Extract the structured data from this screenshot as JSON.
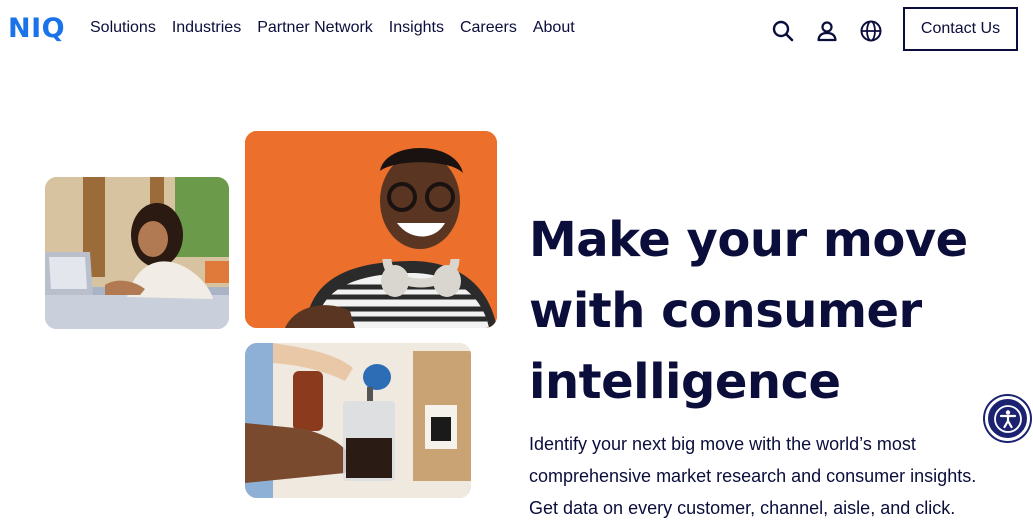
{
  "brand": {
    "logo_text": "NIQ",
    "accent": "#1a73e8",
    "text_color": "#0b0d3b"
  },
  "nav": {
    "items": [
      {
        "label": "Solutions"
      },
      {
        "label": "Industries"
      },
      {
        "label": "Partner Network"
      },
      {
        "label": "Insights"
      },
      {
        "label": "Careers"
      },
      {
        "label": "About"
      }
    ]
  },
  "header_icons": [
    "search-icon",
    "user-icon",
    "globe-icon"
  ],
  "contact_button": {
    "label": "Contact Us"
  },
  "hero": {
    "title_lines": [
      "Make your move",
      "with consumer",
      "intelligence"
    ],
    "description_lines": [
      "Identify your next big move with the world’s most",
      "comprehensive market research and consumer insights.",
      "Get data on every customer, channel, aisle, and click."
    ]
  },
  "images": [
    {
      "name": "woman-laptop-photo"
    },
    {
      "name": "man-headphones-photo"
    },
    {
      "name": "coffee-press-photo"
    }
  ],
  "accessibility_button": {
    "icon": "accessibility-icon",
    "color": "#1b2270"
  }
}
